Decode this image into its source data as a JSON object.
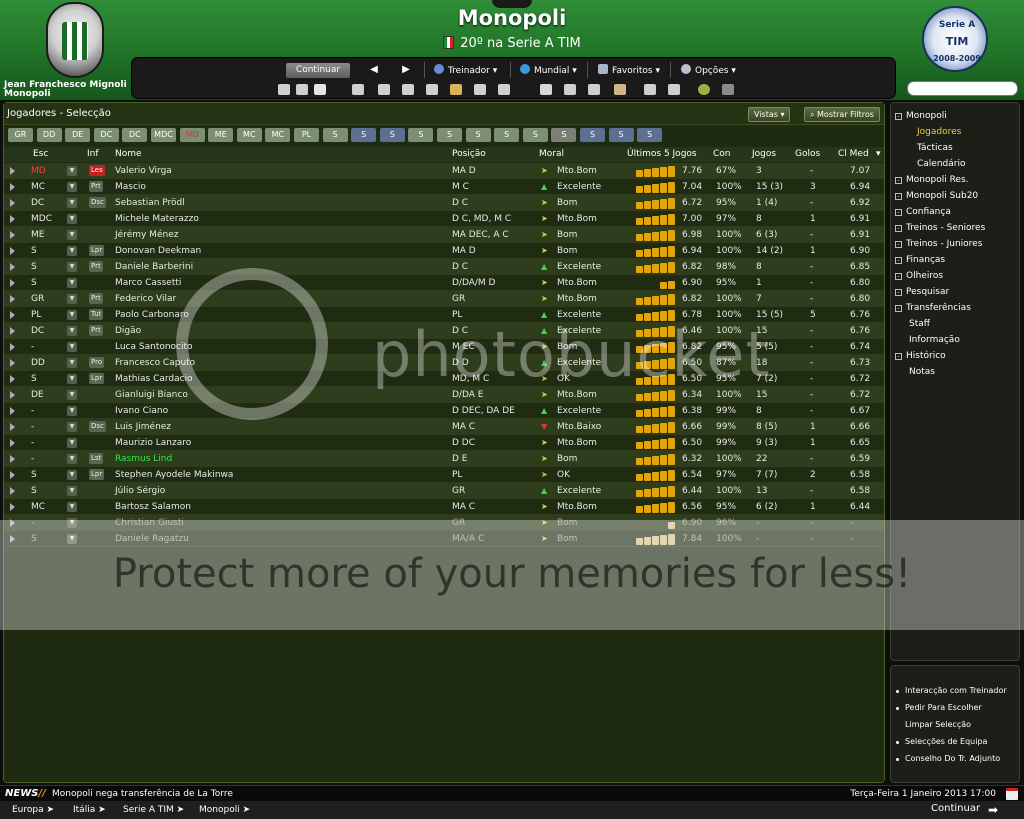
{
  "header": {
    "club_title": "Monopoli",
    "club_subtitle": "20º na Serie A TIM",
    "manager_name": "Jean Franchesco Mignoli",
    "manager_club": "Monopoli",
    "league_logo_line1": "Serie A",
    "league_logo_line2": "TIM",
    "league_logo_line3": "2008-2009",
    "accent_color": "#207327"
  },
  "toolbar": {
    "continue_label": "Continuar",
    "menus": [
      "Treinador",
      "Mundial",
      "Favoritos",
      "Opções"
    ]
  },
  "panel": {
    "title": "Jogadores - Selecção",
    "views_label": "Vistas",
    "filter_label": "Mostrar Filtros"
  },
  "position_tabs": [
    "GR",
    "DD",
    "DE",
    "DC",
    "DC",
    "MDC",
    "MD",
    "ME",
    "MC",
    "MC",
    "PL",
    "S",
    "S",
    "S",
    "S",
    "S",
    "S",
    "S",
    "S",
    "S",
    "S",
    "S",
    "S"
  ],
  "columns": {
    "esc": "Esc",
    "inf": "Inf",
    "nome": "Nome",
    "posicao": "Posição",
    "moral": "Moral",
    "ultimos": "Últimos 5 Jogos",
    "con": "Con",
    "jogos": "Jogos",
    "golos": "Golos",
    "clmed": "Cl Med"
  },
  "players": [
    {
      "esc": "MD",
      "inf": "Les",
      "nome": "Valerio Virga",
      "pos": "MA D",
      "moral": "Mto.Bom",
      "form": "7.76",
      "con": "67%",
      "jogos": "3",
      "golos": "-",
      "cl": "7.07"
    },
    {
      "esc": "MC",
      "inf": "Prt",
      "nome": "Mascio",
      "pos": "M C",
      "moral": "Excelente",
      "form": "7.04",
      "con": "100%",
      "jogos": "15 (3)",
      "golos": "3",
      "cl": "6.94"
    },
    {
      "esc": "DC",
      "inf": "Dsc",
      "nome": "Sebastian Prödl",
      "pos": "D C",
      "moral": "Bom",
      "form": "6.72",
      "con": "95%",
      "jogos": "1 (4)",
      "golos": "-",
      "cl": "6.92"
    },
    {
      "esc": "MDC",
      "inf": "",
      "nome": "Michele Materazzo",
      "pos": "D C, MD, M C",
      "moral": "Mto.Bom",
      "form": "7.00",
      "con": "97%",
      "jogos": "8",
      "golos": "1",
      "cl": "6.91"
    },
    {
      "esc": "ME",
      "inf": "",
      "nome": "Jérémy Ménez",
      "pos": "MA DEC, A C",
      "moral": "Bom",
      "form": "6.98",
      "con": "100%",
      "jogos": "6 (3)",
      "golos": "-",
      "cl": "6.91"
    },
    {
      "esc": "S",
      "inf": "Lpr",
      "nome": "Donovan Deekman",
      "pos": "MA D",
      "moral": "Bom",
      "form": "6.94",
      "con": "100%",
      "jogos": "14 (2)",
      "golos": "1",
      "cl": "6.90"
    },
    {
      "esc": "S",
      "inf": "Prt",
      "nome": "Daniele Barberini",
      "pos": "D C",
      "moral": "Excelente",
      "form": "6.82",
      "con": "98%",
      "jogos": "8",
      "golos": "-",
      "cl": "6.85"
    },
    {
      "esc": "S",
      "inf": "",
      "nome": "Marco Cassetti",
      "pos": "D/DA/M D",
      "moral": "Mto.Bom",
      "form": "6.90",
      "con": "95%",
      "jogos": "1",
      "golos": "-",
      "cl": "6.80"
    },
    {
      "esc": "GR",
      "inf": "Prt",
      "nome": "Federico Vilar",
      "pos": "GR",
      "moral": "Mto.Bom",
      "form": "6.82",
      "con": "100%",
      "jogos": "7",
      "golos": "-",
      "cl": "6.80"
    },
    {
      "esc": "PL",
      "inf": "Tut",
      "nome": "Paolo Carbonaro",
      "pos": "PL",
      "moral": "Excelente",
      "form": "6.78",
      "con": "100%",
      "jogos": "15 (5)",
      "golos": "5",
      "cl": "6.76"
    },
    {
      "esc": "DC",
      "inf": "Prt",
      "nome": "Digão",
      "pos": "D C",
      "moral": "Excelente",
      "form": "6.46",
      "con": "100%",
      "jogos": "15",
      "golos": "-",
      "cl": "6.76"
    },
    {
      "esc": "-",
      "inf": "",
      "nome": "Luca Santonocito",
      "pos": "M EC",
      "moral": "Bom",
      "form": "6.82",
      "con": "95%",
      "jogos": "5 (5)",
      "golos": "-",
      "cl": "6.74"
    },
    {
      "esc": "DD",
      "inf": "Pro",
      "nome": "Francesco Caputo",
      "pos": "D D",
      "moral": "Excelente",
      "form": "6.50",
      "con": "87%",
      "jogos": "18",
      "golos": "-",
      "cl": "6.73"
    },
    {
      "esc": "S",
      "inf": "Lpr",
      "nome": "Mathias Cardacio",
      "pos": "MD, M C",
      "moral": "OK",
      "form": "6.50",
      "con": "95%",
      "jogos": "7 (2)",
      "golos": "-",
      "cl": "6.72"
    },
    {
      "esc": "DE",
      "inf": "",
      "nome": "Gianluigi Bianco",
      "pos": "D/DA E",
      "moral": "Mto.Bom",
      "form": "6.34",
      "con": "100%",
      "jogos": "15",
      "golos": "-",
      "cl": "6.72"
    },
    {
      "esc": "-",
      "inf": "",
      "nome": "Ivano Ciano",
      "pos": "D DEC, DA DE",
      "moral": "Excelente",
      "form": "6.38",
      "con": "99%",
      "jogos": "8",
      "golos": "-",
      "cl": "6.67"
    },
    {
      "esc": "-",
      "inf": "Dsc",
      "nome": "Luis Jiménez",
      "pos": "MA C",
      "moral": "Mto.Baixo",
      "form": "6.66",
      "con": "99%",
      "jogos": "8 (5)",
      "golos": "1",
      "cl": "6.66"
    },
    {
      "esc": "-",
      "inf": "",
      "nome": "Maurizio Lanzaro",
      "pos": "D DC",
      "moral": "Mto.Bom",
      "form": "6.50",
      "con": "99%",
      "jogos": "9 (3)",
      "golos": "1",
      "cl": "6.65"
    },
    {
      "esc": "-",
      "inf": "Lst",
      "nome": "Rasmus Lind",
      "pos": "D E",
      "moral": "Bom",
      "form": "6.32",
      "con": "100%",
      "jogos": "22",
      "golos": "-",
      "cl": "6.59"
    },
    {
      "esc": "S",
      "inf": "Lpr",
      "nome": "Stephen Ayodele Makinwa",
      "pos": "PL",
      "moral": "OK",
      "form": "6.54",
      "con": "97%",
      "jogos": "7 (7)",
      "golos": "2",
      "cl": "6.58"
    },
    {
      "esc": "S",
      "inf": "",
      "nome": "Júlio Sérgio",
      "pos": "GR",
      "moral": "Excelente",
      "form": "6.44",
      "con": "100%",
      "jogos": "13",
      "golos": "-",
      "cl": "6.58"
    },
    {
      "esc": "MC",
      "inf": "",
      "nome": "Bartosz Salamon",
      "pos": "MA C",
      "moral": "Mto.Bom",
      "form": "6.56",
      "con": "95%",
      "jogos": "6 (2)",
      "golos": "1",
      "cl": "6.44"
    },
    {
      "esc": "-",
      "inf": "",
      "nome": "Christian Giusti",
      "pos": "GR",
      "moral": "Bom",
      "form": "6.90",
      "con": "96%",
      "jogos": "-",
      "golos": "-",
      "cl": "-"
    },
    {
      "esc": "S",
      "inf": "",
      "nome": "Daniele Ragatzu",
      "pos": "MA/A C",
      "moral": "Bom",
      "form": "7.84",
      "con": "100%",
      "jogos": "-",
      "golos": "-",
      "cl": "-"
    }
  ],
  "sidebar": {
    "items": [
      "Monopoli",
      "Jogadores",
      "Tácticas",
      "Calendário",
      "Monopoli Res.",
      "Monopoli Sub20",
      "Confiança",
      "Treinos - Seniores",
      "Treinos - Juniores",
      "Finanças",
      "Olheiros",
      "Pesquisar",
      "Transferências",
      "Staff",
      "Informação",
      "Histórico",
      "Notas"
    ]
  },
  "actions": [
    "Interacção com Treinador",
    "Pedir Para Escolher",
    "Limpar Selecção",
    "Selecções de Equipa",
    "Conselho Do Tr. Adjunto"
  ],
  "news": {
    "tag": "NEWS",
    "tag_suffix": "//",
    "headline": "Monopoli nega transferência de La Torre",
    "date": "Terça-Feira 1 Janeiro 2013 17:00"
  },
  "breadcrumb": [
    "Europa",
    "Itália",
    "Serie A TIM",
    "Monopoli"
  ],
  "footer": {
    "continue_label": "Continuar"
  },
  "watermark": {
    "brand": "photobucket",
    "banner": "Protect more of your memories for less!"
  }
}
